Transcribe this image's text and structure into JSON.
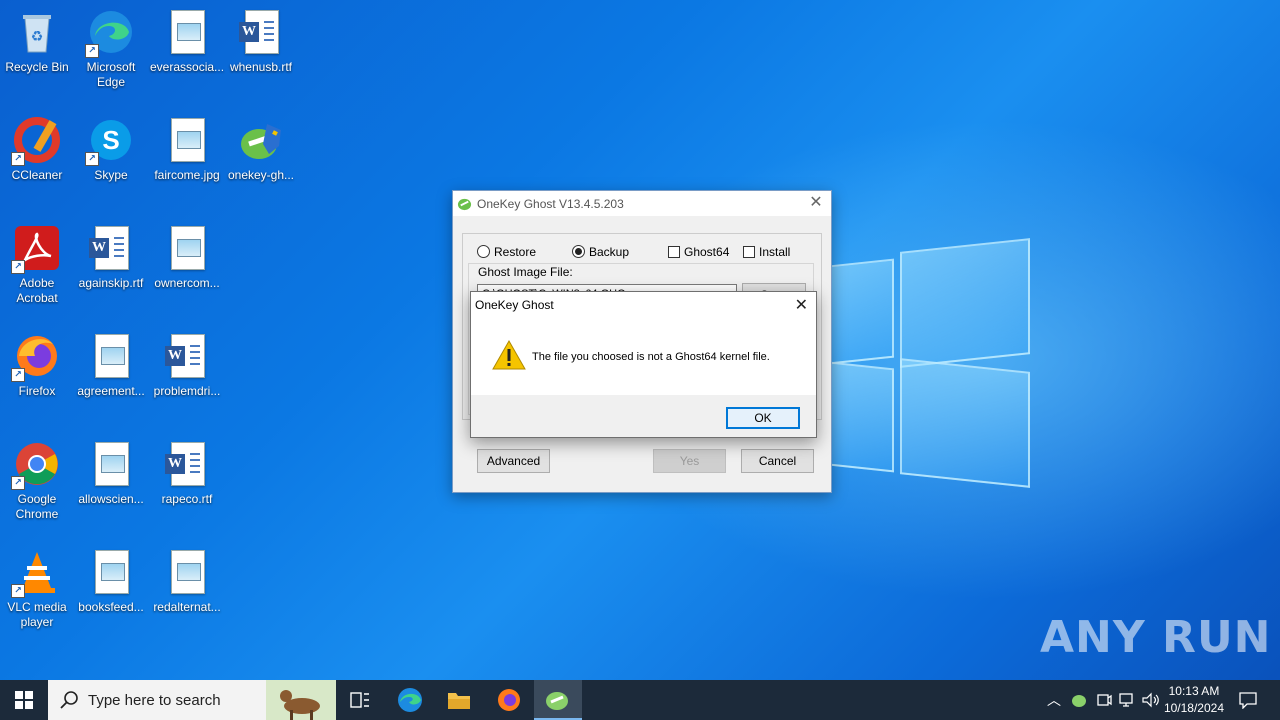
{
  "desktop": {
    "icons": [
      {
        "label": "Recycle Bin"
      },
      {
        "label": "Microsoft Edge"
      },
      {
        "label": "everassocia..."
      },
      {
        "label": "whenusb.rtf"
      },
      {
        "label": "CCleaner"
      },
      {
        "label": "Skype"
      },
      {
        "label": "faircome.jpg"
      },
      {
        "label": "onekey-gh..."
      },
      {
        "label": "Adobe Acrobat"
      },
      {
        "label": "againskip.rtf"
      },
      {
        "label": "ownercom..."
      },
      {
        "label": "Firefox"
      },
      {
        "label": "agreement..."
      },
      {
        "label": "problemdri..."
      },
      {
        "label": "Google Chrome"
      },
      {
        "label": "allowscien..."
      },
      {
        "label": "rapeco.rtf"
      },
      {
        "label": "VLC media player"
      },
      {
        "label": "booksfeed..."
      },
      {
        "label": "redalternat..."
      }
    ]
  },
  "main_window": {
    "title": "OneKey Ghost V13.4.5.203",
    "restore_label": "Restore",
    "backup_label": "Backup",
    "ghost64_label": "Ghost64",
    "install_label": "Install",
    "image_file_label": "Ghost Image File:",
    "image_path_value": "C:\\GHOST\\C_WIN8x64.GHO",
    "save_label": "Save",
    "advanced_label": "Advanced",
    "yes_label": "Yes",
    "cancel_label": "Cancel",
    "selected_mode": "Backup"
  },
  "message_box": {
    "title": "OneKey Ghost",
    "message": "The file you choosed is not a Ghost64 kernel file.",
    "ok_label": "OK"
  },
  "taskbar": {
    "search_placeholder": "Type here to search",
    "time": "10:13 AM",
    "date": "10/18/2024"
  },
  "watermark": "ANY RUN",
  "colors": {
    "accent": "#0078d7",
    "taskbar": "#1c2a3a",
    "warning": "#f5c400"
  }
}
